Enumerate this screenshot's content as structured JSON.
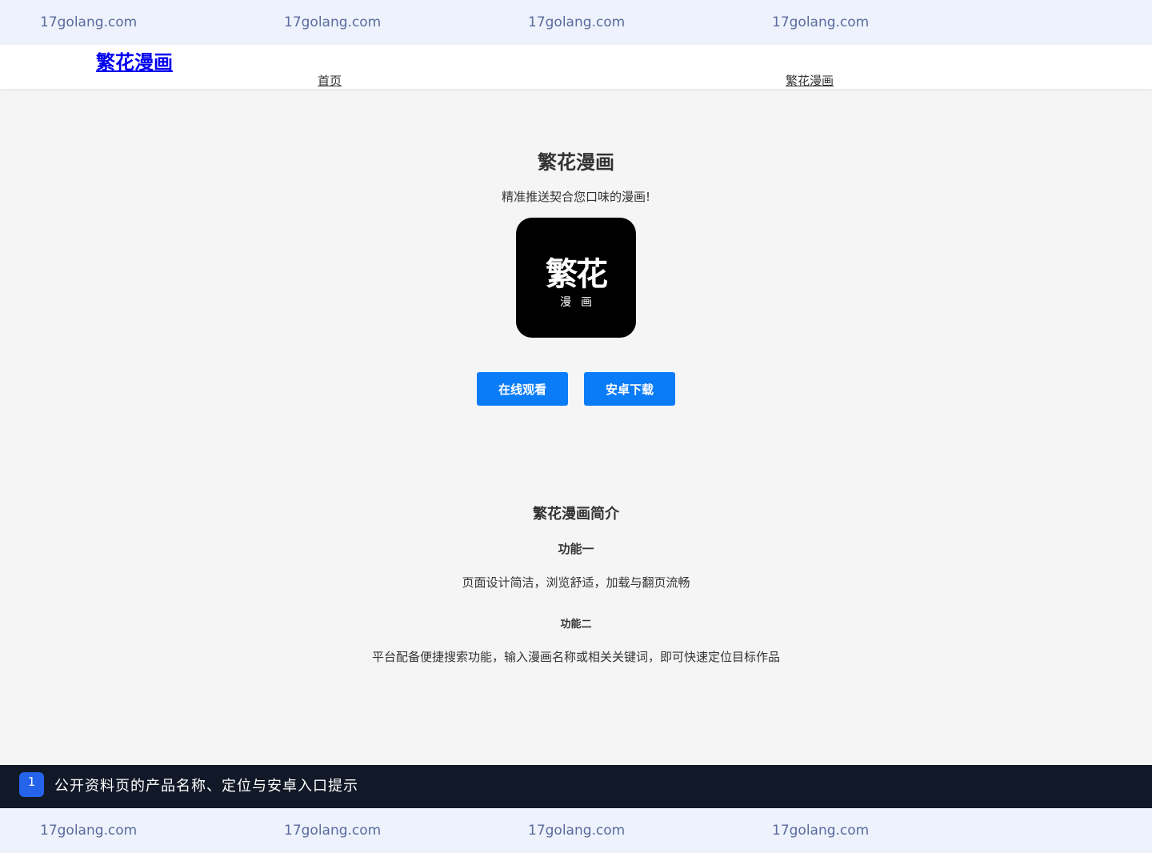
{
  "watermark": {
    "top": [
      "17golang.com",
      "17golang.com",
      "17golang.com",
      "17golang.com"
    ],
    "bottom": [
      "17golang.com",
      "17golang.com",
      "17golang.com",
      "17golang.com"
    ]
  },
  "header": {
    "logo": "繁花漫画",
    "nav": [
      "首页",
      "繁花漫画"
    ]
  },
  "hero": {
    "title": "繁花漫画",
    "subtitle": "精准推送契合您口味的漫画!",
    "icon_text_main": "繁花",
    "icon_text_sub": "漫画",
    "btn_online": "在线观看",
    "btn_android": "安卓下载"
  },
  "intro": {
    "title": "繁花漫画简介",
    "features": [
      {
        "title": "功能一",
        "desc": "页面设计简洁，浏览舒适，加载与翻页流畅"
      },
      {
        "title": "功能二",
        "desc": "平台配备便捷搜索功能，输入漫画名称或相关关键词，即可快速定位目标作品"
      }
    ]
  },
  "notice": {
    "badge": "1",
    "text": "公开资料页的产品名称、定位与安卓入口提示"
  },
  "colors": {
    "accent": "#0a7cf8",
    "watermark_bg": "#edf2fc",
    "notice_bg": "#111827",
    "badge": "#2563eb"
  }
}
